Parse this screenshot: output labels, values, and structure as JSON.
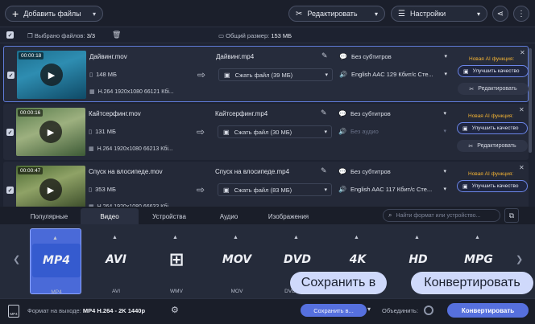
{
  "toolbar": {
    "add_files": "Добавить файлы",
    "edit": "Редактировать",
    "settings": "Настройки"
  },
  "selection": {
    "selected_label": "Выбрано файлов:",
    "selected_value": "3/3",
    "total_label": "Общий размер:",
    "total_value": "153 МБ"
  },
  "files": [
    {
      "duration": "00:00:18",
      "source_name": "Дайвинг.mov",
      "size": "148 МБ",
      "meta": "H.264 1920x1080 66121 Кбі...",
      "output_name": "Дайвинг.mp4",
      "compress": "Сжать файл (39 МБ)",
      "subtitles": "Без субтитров",
      "audio": "English AAC 129 Кбит/с Сте...",
      "ai_label": "Новая AI функция:",
      "improve": "Улучшить качество",
      "edit": "Редактировать"
    },
    {
      "duration": "00:00:16",
      "source_name": "Кайтсерфинг.mov",
      "size": "131 МБ",
      "meta": "H.264 1920x1080 66213 Кбі...",
      "output_name": "Кайтсерфинг.mp4",
      "compress": "Сжать файл (30 МБ)",
      "subtitles": "Без субтитров",
      "audio": "Без аудио",
      "ai_label": "Новая AI функция:",
      "improve": "Улучшить качество",
      "edit": "Редактировать"
    },
    {
      "duration": "00:00:47",
      "source_name": "Спуск на влосипеде.mov",
      "size": "353 МБ",
      "meta": "H.264 1920x1080 66633 Кбі...",
      "output_name": "Спуск на влосипеде.mp4",
      "compress": "Сжать файл (83 МБ)",
      "subtitles": "Без субтитров",
      "audio": "English AAC 117 Кбит/с Сте...",
      "ai_label": "Новая AI функция:",
      "improve": "Улучшить качество",
      "edit": "Редактировать"
    }
  ],
  "format_tabs": [
    "Популярные",
    "Видео",
    "Устройства",
    "Аудио",
    "Изображения"
  ],
  "format_tab_selected": "Видео",
  "format_search_placeholder": "Найти формат или устройство...",
  "formats": [
    {
      "badge": "MP4",
      "label": "MP4"
    },
    {
      "badge": "AVI",
      "label": "AVI"
    },
    {
      "badge": "⊞",
      "label": "WMV"
    },
    {
      "badge": "MOV",
      "label": "MOV"
    },
    {
      "badge": "DVD",
      "label": "DVD-сов..."
    },
    {
      "badge": "4K",
      "label": ""
    },
    {
      "badge": "HD",
      "label": ""
    },
    {
      "badge": "MPG",
      "label": ""
    }
  ],
  "callouts": {
    "save_in": "Сохранить в",
    "convert": "Конвертировать"
  },
  "bottom": {
    "output_label": "Формат на выходе:",
    "output_value": "MP4 H.264 - 2K 1440p",
    "save_in": "Сохранить в...",
    "join": "Объединить:",
    "convert": "Конвертировать",
    "output_icon_text": "MP4"
  },
  "colors": {
    "accent": "#5670de",
    "ai_label": "#f2b233",
    "background": "#1d2230"
  }
}
